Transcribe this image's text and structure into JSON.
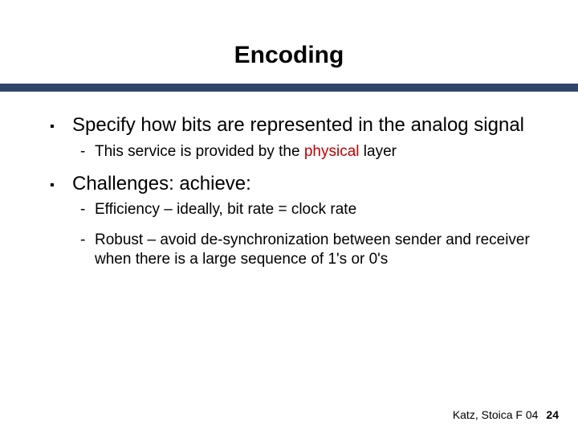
{
  "title": "Encoding",
  "bullets": [
    {
      "text": "Specify how bits are represented in the analog signal",
      "sub": [
        {
          "prefix": "This service is provided by the ",
          "red": "physical",
          "suffix": " layer"
        }
      ]
    },
    {
      "text": "Challenges: achieve:",
      "sub": [
        {
          "prefix": "Efficiency – ideally, bit rate = clock rate",
          "red": "",
          "suffix": ""
        },
        {
          "prefix": "Robust – avoid de-synchronization between sender and receiver when there is a large sequence of 1's or 0's",
          "red": "",
          "suffix": ""
        }
      ]
    }
  ],
  "footer": {
    "credit": "Katz, Stoica F 04",
    "page": "24"
  }
}
